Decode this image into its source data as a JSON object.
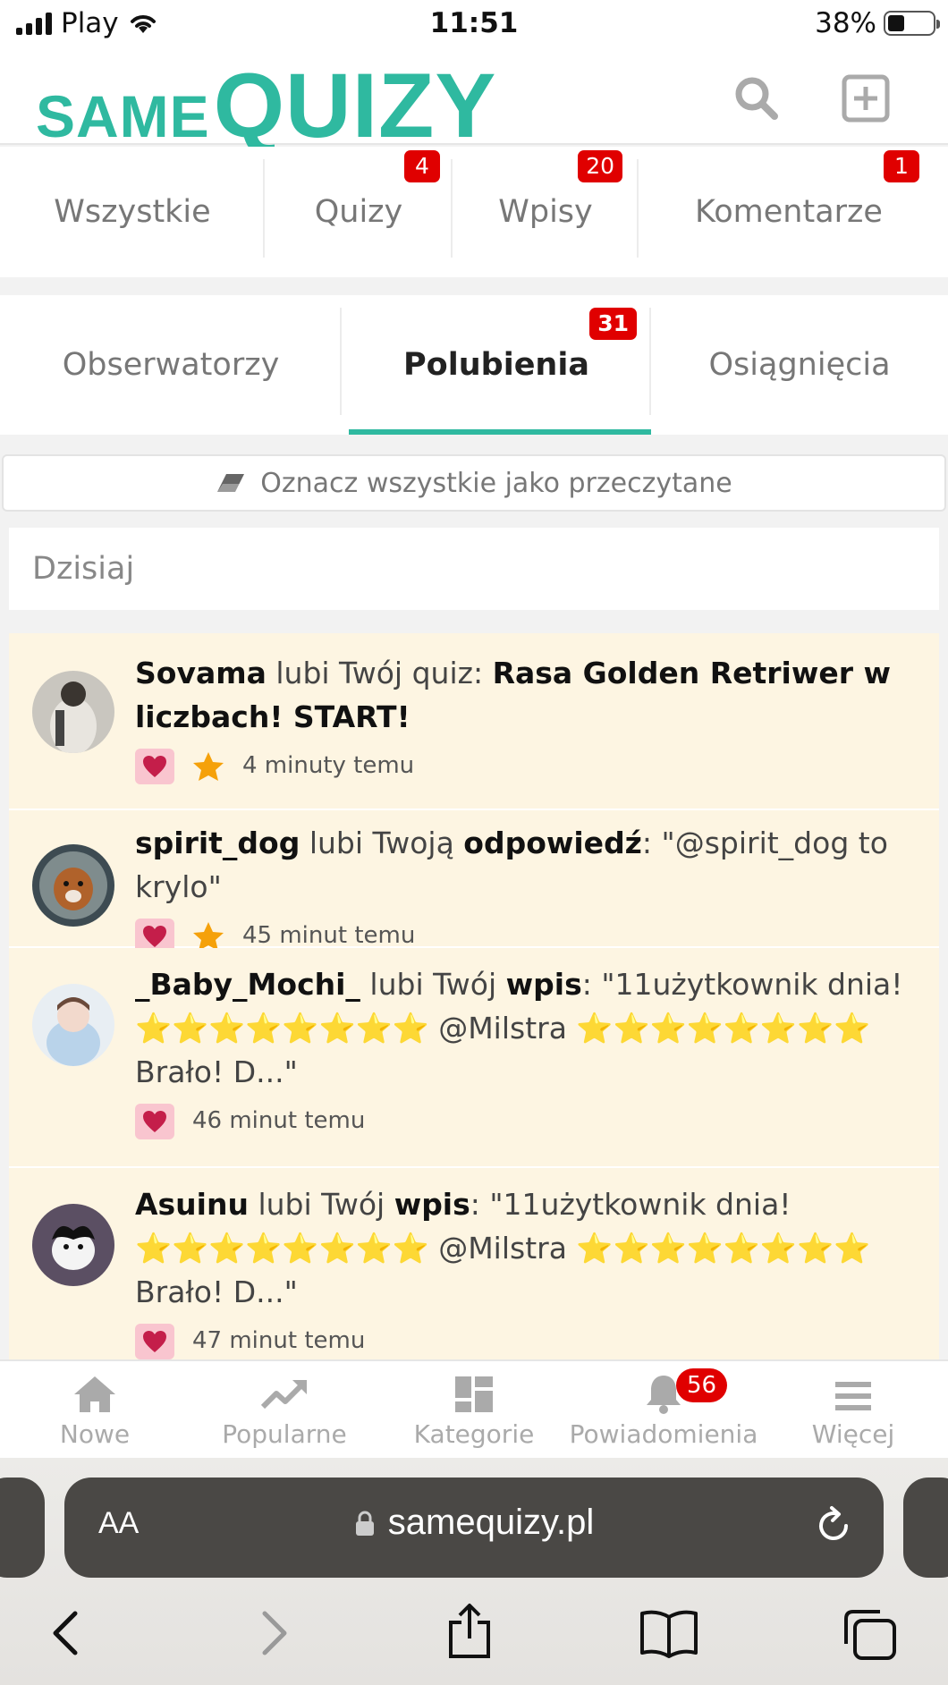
{
  "status_bar": {
    "carrier": "Play",
    "time": "11:51",
    "battery": "38%"
  },
  "header": {
    "logo_small": "SAME",
    "logo_big": "QUIZY",
    "search_icon": "search-icon",
    "add_icon": "plus-square-icon"
  },
  "tabs_row1": [
    {
      "label": "Wszystkie",
      "badge": ""
    },
    {
      "label": "Quizy",
      "badge": "4"
    },
    {
      "label": "Wpisy",
      "badge": "20"
    },
    {
      "label": "Komentarze",
      "badge": "1"
    }
  ],
  "tabs_row2": [
    {
      "label": "Obserwatorzy",
      "badge": ""
    },
    {
      "label": "Polubienia",
      "badge": "31",
      "active": true
    },
    {
      "label": "Osiągnięcia",
      "badge": ""
    }
  ],
  "mark_all_label": "Oznacz wszystkie jako przeczytane",
  "day_label": "Dzisiaj",
  "notifications": [
    {
      "user": "Sovama",
      "action": " lubi Twój quiz: ",
      "object": "Rasa Golden Retriwer w liczbach! START!",
      "time": "4 minuty temu"
    },
    {
      "user": "spirit_dog",
      "action": " lubi Twoją ",
      "object": "odpowiedź",
      "quote": ": \"@spirit_dog to krylo\"",
      "time": "45 minut temu"
    },
    {
      "user": "_Baby_Mochi_",
      "action": " lubi Twój ",
      "object": "wpis",
      "quote_start": ": \"11użytkownik dnia!",
      "stars_line": "⭐⭐⭐⭐⭐⭐⭐⭐ @Milstra ⭐⭐⭐⭐⭐⭐⭐⭐",
      "quote_end": "Brało! D...\"",
      "time": "46 minut temu"
    },
    {
      "user": "Asuinu",
      "action": " lubi Twój ",
      "object": "wpis",
      "quote_start": ": \"11użytkownik dnia!",
      "stars_line": "⭐⭐⭐⭐⭐⭐⭐⭐ @Milstra ⭐⭐⭐⭐⭐⭐⭐⭐",
      "quote_end": "Brało! D...\"",
      "time": "47 minut temu"
    }
  ],
  "bottom_nav": [
    {
      "label": "Nowe",
      "icon": "home-icon"
    },
    {
      "label": "Popularne",
      "icon": "trending-icon"
    },
    {
      "label": "Kategorie",
      "icon": "grid-icon"
    },
    {
      "label": "Powiadomienia",
      "icon": "bell-icon",
      "badge": "56"
    },
    {
      "label": "Więcej",
      "icon": "menu-icon"
    }
  ],
  "browser": {
    "text_size": "AA",
    "url": "samequizy.pl"
  },
  "colors": {
    "brand": "#2fb9a0",
    "badge": "#e00000",
    "highlight": "#fdf5e2"
  }
}
